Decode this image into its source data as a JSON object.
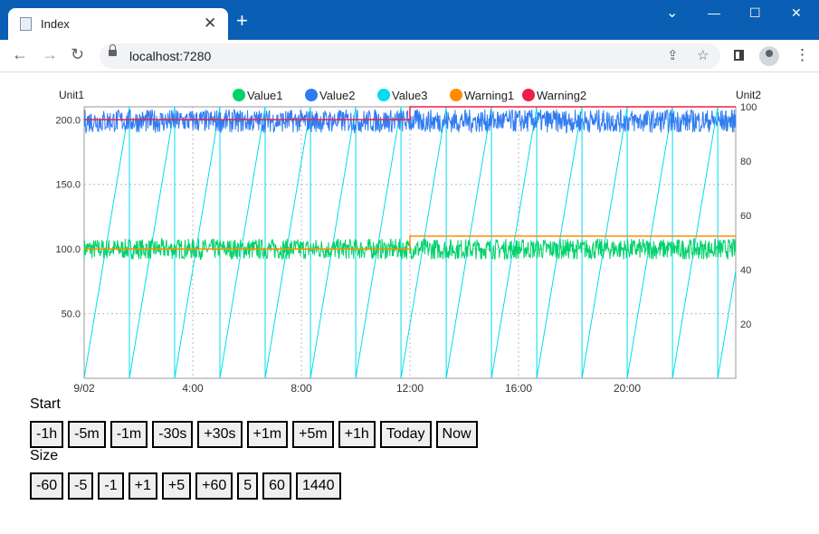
{
  "browser": {
    "tab_title": "Index",
    "tab_close": "✕",
    "new_tab": "+",
    "url": "localhost:7280",
    "window_controls": {
      "minimize": "—",
      "maximize": "☐",
      "close": "✕",
      "tab_search": "⌄"
    }
  },
  "colors": {
    "titlebar": "#0a5fb4",
    "value1": "#00d26a",
    "value2": "#2f7bf2",
    "value3": "#00dcf0",
    "warning1": "#ff8c00",
    "warning2": "#f01f46"
  },
  "chart_data": {
    "type": "line",
    "title": "",
    "ylabel_left": "Unit1",
    "ylabel_right": "Unit2",
    "legend_placement": "top-center",
    "grid": true,
    "x_tick_labels": [
      "9/02",
      "4:00",
      "8:00",
      "12:00",
      "16:00",
      "20:00"
    ],
    "x_range_hours": [
      0,
      24
    ],
    "y_left_ticks": [
      "200.0",
      "150.0",
      "100.0",
      "50.0"
    ],
    "ylim_left": [
      0,
      210
    ],
    "y_right_ticks": [
      "100",
      "80",
      "60",
      "40",
      "20"
    ],
    "ylim_right": [
      0,
      100
    ],
    "series": [
      {
        "name": "Value1",
        "axis": "left",
        "pattern": "noise",
        "mean": 100,
        "spread": 16
      },
      {
        "name": "Value2",
        "axis": "left",
        "pattern": "noise",
        "mean": 199,
        "spread": 18
      },
      {
        "name": "Value3",
        "axis": "right",
        "pattern": "sawtooth",
        "min": 0,
        "max": 100,
        "period_hours": 1.667
      },
      {
        "name": "Warning1",
        "axis": "left",
        "pattern": "step",
        "points": [
          [
            0,
            100
          ],
          [
            12,
            100
          ],
          [
            12,
            110
          ],
          [
            24,
            110
          ]
        ]
      },
      {
        "name": "Warning2",
        "axis": "left",
        "pattern": "step",
        "points": [
          [
            0,
            200
          ],
          [
            12,
            200
          ],
          [
            12,
            210
          ],
          [
            24,
            210
          ]
        ]
      }
    ]
  },
  "controls": {
    "start_label": "Start",
    "start_buttons": [
      "-1h",
      "-5m",
      "-1m",
      "-30s",
      "+30s",
      "+1m",
      "+5m",
      "+1h",
      "Today",
      "Now"
    ],
    "size_label": "Size",
    "size_buttons": [
      "-60",
      "-5",
      "-1",
      "+1",
      "+5",
      "+60",
      "5",
      "60",
      "1440"
    ]
  }
}
